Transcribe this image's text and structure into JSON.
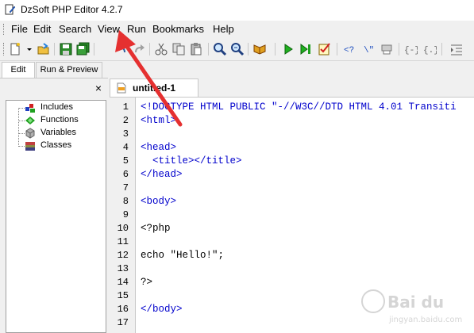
{
  "window": {
    "title": "DzSoft PHP Editor 4.2.7"
  },
  "menu": [
    "File",
    "Edit",
    "Search",
    "View",
    "Run",
    "Bookmarks",
    "Help"
  ],
  "toolbar": {
    "icons": [
      "new-file-icon",
      "dropdown-icon",
      "open-folder-icon",
      "save-icon",
      "save-all-icon",
      "undo-icon",
      "redo-icon",
      "cut-icon",
      "copy-icon",
      "paste-icon",
      "find-icon",
      "find-next-icon",
      "book-icon",
      "run-icon",
      "run-step-icon",
      "check-icon",
      "php-tag-icon",
      "quote-icon",
      "print-icon",
      "brace-left-icon",
      "brace-right-icon",
      "indent-icon"
    ]
  },
  "left_tabs": {
    "edit": "Edit",
    "run_preview": "Run & Preview"
  },
  "left_panel": {
    "close": "×",
    "tree": [
      {
        "label": "Includes",
        "icon": "includes-icon"
      },
      {
        "label": "Functions",
        "icon": "functions-icon"
      },
      {
        "label": "Variables",
        "icon": "variables-icon"
      },
      {
        "label": "Classes",
        "icon": "classes-icon"
      }
    ]
  },
  "document": {
    "tab_name": "untitled-1"
  },
  "editor": {
    "line_numbers": [
      "1",
      "2",
      "3",
      "4",
      "5",
      "6",
      "7",
      "8",
      "9",
      "10",
      "11",
      "12",
      "13",
      "14",
      "15",
      "16",
      "17"
    ],
    "lines": [
      "<!DOCTYPE HTML PUBLIC \"-//W3C//DTD HTML 4.01 Transiti",
      "<html>",
      "",
      "<head>",
      "  <title></title>",
      "</head>",
      "",
      "<body>",
      "",
      "<?php",
      "",
      "echo \"Hello!\";",
      "",
      "?>",
      "",
      "</body>",
      ""
    ]
  },
  "colors": {
    "tag": "#0000cc",
    "string": "#000080",
    "annotation_arrow": "#e53030"
  }
}
